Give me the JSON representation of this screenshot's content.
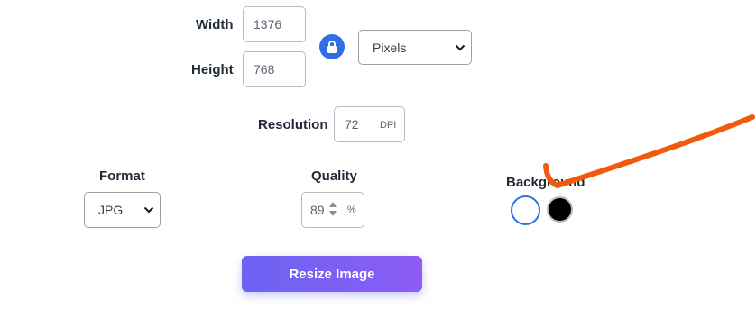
{
  "dimensions": {
    "width_label": "Width",
    "width_value": "1376",
    "height_label": "Height",
    "height_value": "768",
    "unit_select": "Pixels",
    "lock_icon": "lock-icon"
  },
  "resolution": {
    "label": "Resolution",
    "value": "72",
    "unit": "DPI"
  },
  "format": {
    "label": "Format",
    "selected": "JPG"
  },
  "quality": {
    "label": "Quality",
    "value": "89",
    "unit": "%"
  },
  "background": {
    "label": "Background",
    "options": [
      {
        "name": "white",
        "color": "#ffffff",
        "selected": true
      },
      {
        "name": "black",
        "color": "#000000",
        "selected": false
      }
    ]
  },
  "actions": {
    "resize_label": "Resize Image"
  },
  "colors": {
    "accent_blue": "#2f6fe4",
    "button_gradient_start": "#6b63f2",
    "button_gradient_end": "#8d5cf5",
    "annotation_arrow": "#f15a0c"
  }
}
